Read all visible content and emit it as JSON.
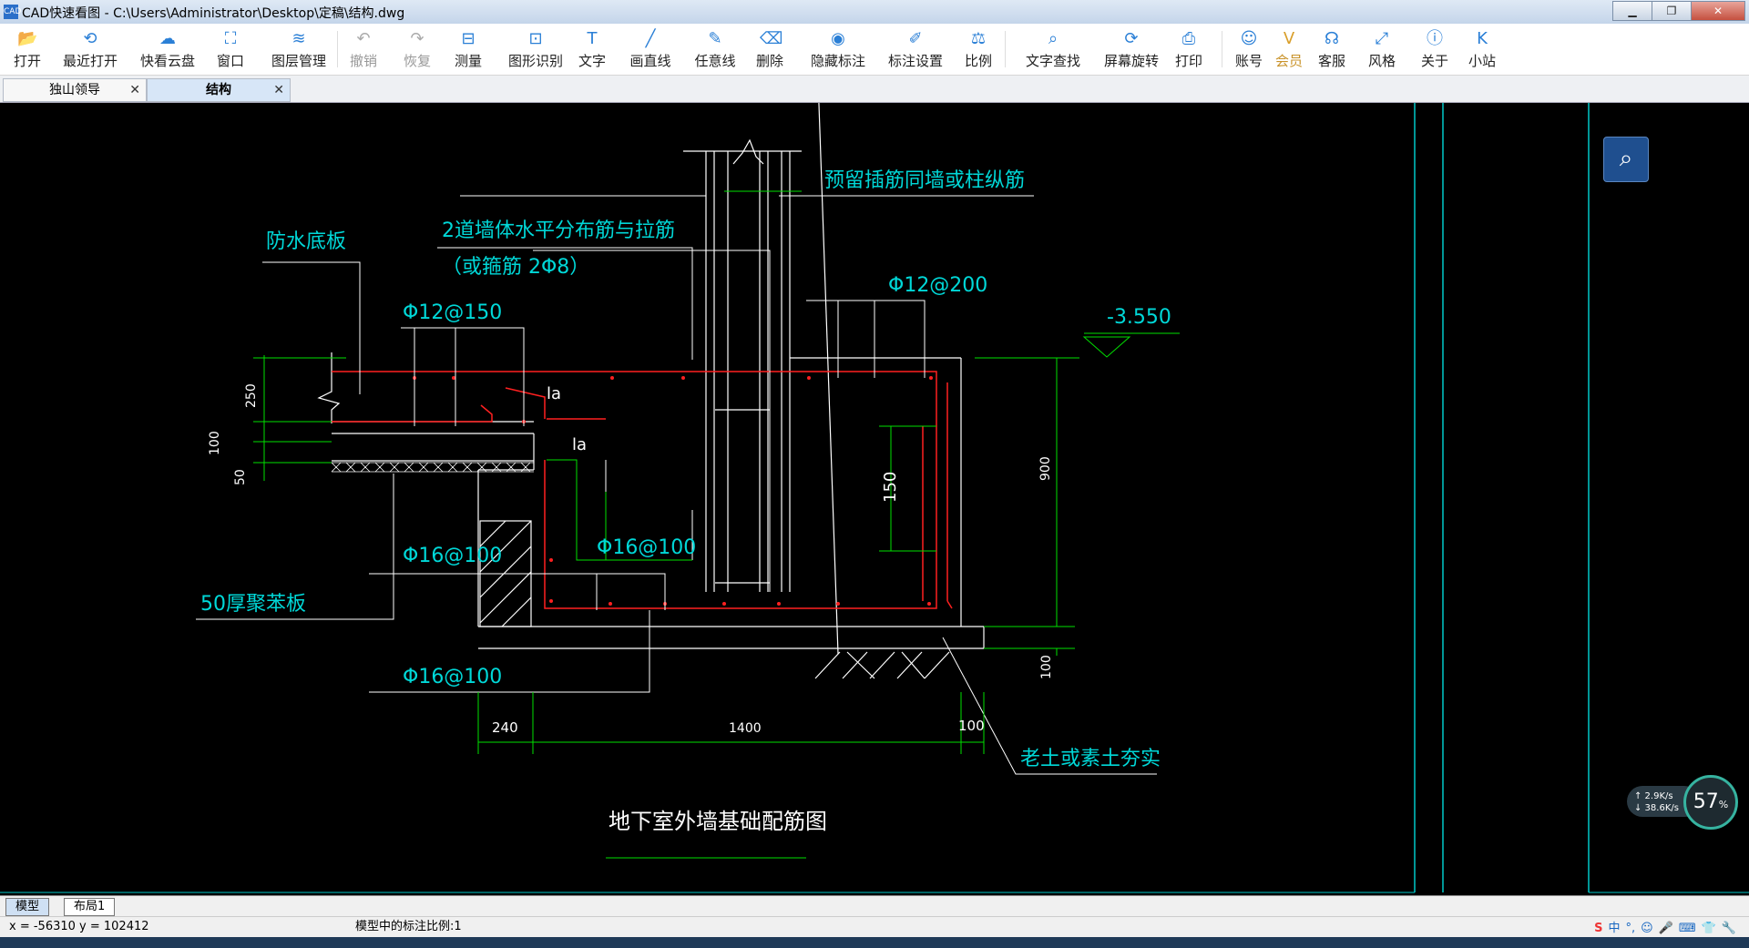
{
  "window": {
    "title": "CAD快速看图 - C:\\Users\\Administrator\\Desktop\\定稿\\结构.dwg",
    "app_icon": "CAD",
    "minimize": "▁",
    "maximize": "❐",
    "close": "✕"
  },
  "toolbar": {
    "items": [
      {
        "label": "打开",
        "icon": "folder-open-icon",
        "glyph": "📂"
      },
      {
        "label": "最近打开",
        "icon": "history-icon",
        "glyph": "⟲"
      },
      {
        "label": "快看云盘",
        "icon": "cloud-icon",
        "glyph": "☁"
      },
      {
        "label": "窗口",
        "icon": "window-icon",
        "glyph": "⛶"
      },
      {
        "label": "图层管理",
        "icon": "layers-icon",
        "glyph": "≋"
      },
      {
        "label": "撤销",
        "icon": "undo-icon",
        "glyph": "↶"
      },
      {
        "label": "恢复",
        "icon": "redo-icon",
        "glyph": "↷"
      },
      {
        "label": "测量",
        "icon": "measure-icon",
        "glyph": "⊟"
      },
      {
        "label": "图形识别",
        "icon": "shape-recognize-icon",
        "glyph": "⊡"
      },
      {
        "label": "文字",
        "icon": "text-icon",
        "glyph": "T"
      },
      {
        "label": "画直线",
        "icon": "line-icon",
        "glyph": "╱"
      },
      {
        "label": "任意线",
        "icon": "freehand-icon",
        "glyph": "✎"
      },
      {
        "label": "删除",
        "icon": "eraser-icon",
        "glyph": "⌫"
      },
      {
        "label": "隐藏标注",
        "icon": "eye-hide-icon",
        "glyph": "◉"
      },
      {
        "label": "标注设置",
        "icon": "annotation-settings-icon",
        "glyph": "✐"
      },
      {
        "label": "比例",
        "icon": "scale-icon",
        "glyph": "⚖"
      },
      {
        "label": "文字查找",
        "icon": "text-search-icon",
        "glyph": "⌕"
      },
      {
        "label": "屏幕旋转",
        "icon": "rotate-screen-icon",
        "glyph": "⟳"
      },
      {
        "label": "打印",
        "icon": "printer-icon",
        "glyph": "⎙"
      },
      {
        "label": "账号",
        "icon": "user-icon",
        "glyph": "☺"
      },
      {
        "label": "会员",
        "icon": "vip-icon",
        "glyph": "V"
      },
      {
        "label": "客服",
        "icon": "headset-icon",
        "glyph": "☊"
      },
      {
        "label": "风格",
        "icon": "style-icon",
        "glyph": "⤢"
      },
      {
        "label": "关于",
        "icon": "info-icon",
        "glyph": "ⓘ"
      },
      {
        "label": "小站",
        "icon": "k-station-icon",
        "glyph": "K"
      }
    ]
  },
  "tabs": [
    {
      "label": "独山领导",
      "close": "✕"
    },
    {
      "label": "结构",
      "close": "✕"
    }
  ],
  "drawing": {
    "title": "地下室外墙基础配筋图",
    "labels": {
      "reserve_bars": "预留插筋同墙或柱纵筋",
      "wall_bars": "2道墙体水平分布筋与拉筋",
      "wall_bars_alt": "（或箍筋  2Φ8）",
      "waterproof": "防水底板",
      "bar_top_left": "Φ12@150",
      "bar_top_right": "Φ12@200",
      "elevation": "-3.550",
      "la1": "la",
      "la2": "la",
      "bar_mid_right": "Φ16@100",
      "bar_mid_left": "Φ16@100",
      "foam_board": "50厚聚苯板",
      "bar_bottom": "Φ16@100",
      "soil": "老土或素土夯实"
    },
    "dims": {
      "d250": "250",
      "d100a": "100",
      "d50": "50",
      "d150": "150",
      "d900": "900",
      "d100b": "100",
      "d240": "240",
      "d1400": "1400",
      "d100c": "100"
    }
  },
  "search_button": "⌕",
  "net": {
    "up": "↑ 2.9K/s",
    "down": "↓ 38.6K/s",
    "percent": "57",
    "unit": "%"
  },
  "layout_tabs": [
    "模型",
    "布局1"
  ],
  "status": {
    "coords": "x = -56310 y = 102412",
    "scale": "模型中的标注比例:1"
  },
  "ime": [
    "S",
    "中",
    "°,",
    "☺",
    "🎤",
    "⌨",
    "👕",
    "🔧"
  ]
}
